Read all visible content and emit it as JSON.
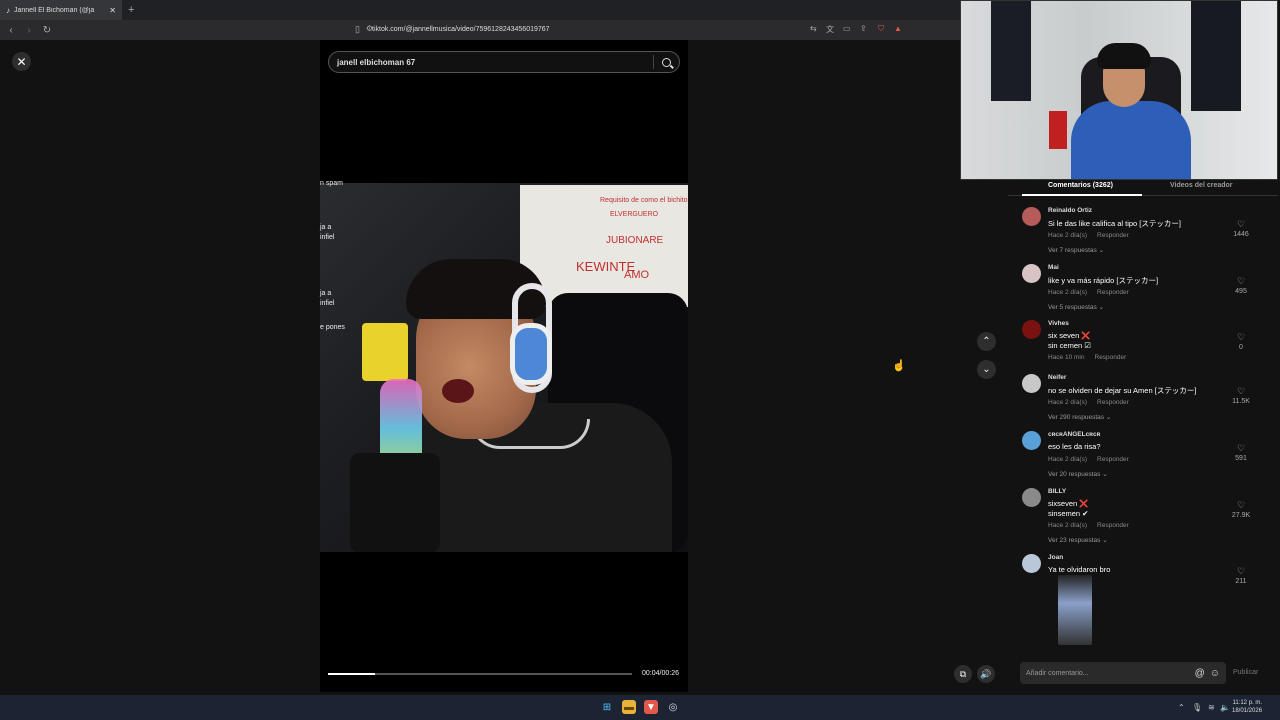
{
  "browser": {
    "tab_title": "Jannell El Bichoman",
    "tab_suffix": "(@ja",
    "new_tab_label": "+",
    "url": "tiktok.com/@jannellmusica/video/7596128243456019767"
  },
  "search": {
    "value": "janell elbichoman 67"
  },
  "video_overlay": {
    "line1": "n spam",
    "line2": "ja a",
    "line3": "infiel",
    "line4": "ja a",
    "line5": "infiel",
    "line6": "e pones"
  },
  "whiteboard": {
    "t1": "Requisito de como el bichito",
    "t2": "ELVERGUERO",
    "t3": "JUBIONARE",
    "t4": "KEWINTE",
    "t5": "AMO"
  },
  "player": {
    "time": "00:04/00:26",
    "progress": 0.154
  },
  "panel_tabs": {
    "comments": "Comentarios (3262)",
    "creator_videos": "Videos del creador"
  },
  "comments": [
    {
      "user": "Reinaldo Ortiz",
      "text": "Si le das like califica al tipo [ステッカー]",
      "time": "Hace 2 día(s)",
      "reply": "Responder",
      "replies": "Ver 7 respuestas",
      "likes": "1446",
      "color": "#b75a5a"
    },
    {
      "user": "Mai",
      "text": "like y va más rápido [ステッカー]",
      "time": "Hace 2 día(s)",
      "reply": "Responder",
      "replies": "Ver 5 respuestas",
      "likes": "495",
      "color": "#d9c4c4"
    },
    {
      "user": "Vivhes",
      "text": "six seven ❌",
      "text2": "sin cemen ☑",
      "time": "Hace 10 min",
      "reply": "Responder",
      "replies": "",
      "likes": "0",
      "color": "#7a1212"
    },
    {
      "user": "Neifer",
      "text": "no se olviden de dejar su Amen [ステッカー]",
      "time": "Hace 2 día(s)",
      "reply": "Responder",
      "replies": "Ver 290 respuestas",
      "likes": "11.5K",
      "color": "#c8c8c8"
    },
    {
      "user": "ᴄʀᴄʀANGELᴄʀᴄʀ",
      "text": "eso les da risa?",
      "time": "Hace 2 día(s)",
      "reply": "Responder",
      "replies": "Ver 20 respuestas",
      "likes": "591",
      "color": "#5aa0d8"
    },
    {
      "user": "BILLY",
      "text": "sixseven ❌",
      "text2": "sinsemen ✔",
      "time": "Hace 2 día(s)",
      "reply": "Responder",
      "replies": "Ver 23 respuestas",
      "likes": "27.9K",
      "color": "#8a8a8a"
    },
    {
      "user": "Joan",
      "text": "Ya te olvidaron bro",
      "time": "",
      "reply": "",
      "replies": "",
      "likes": "211",
      "color": "#b9c7d8"
    }
  ],
  "composer": {
    "placeholder": "Añadir comentario...",
    "publish": "Publicar"
  },
  "clock": {
    "time": "11:12 p. m.",
    "date": "18/01/2026"
  },
  "icons": {
    "close": "✕",
    "up": "⌃",
    "down": "⌄",
    "heart": "♡",
    "mention": "@",
    "emoji": "☺"
  }
}
